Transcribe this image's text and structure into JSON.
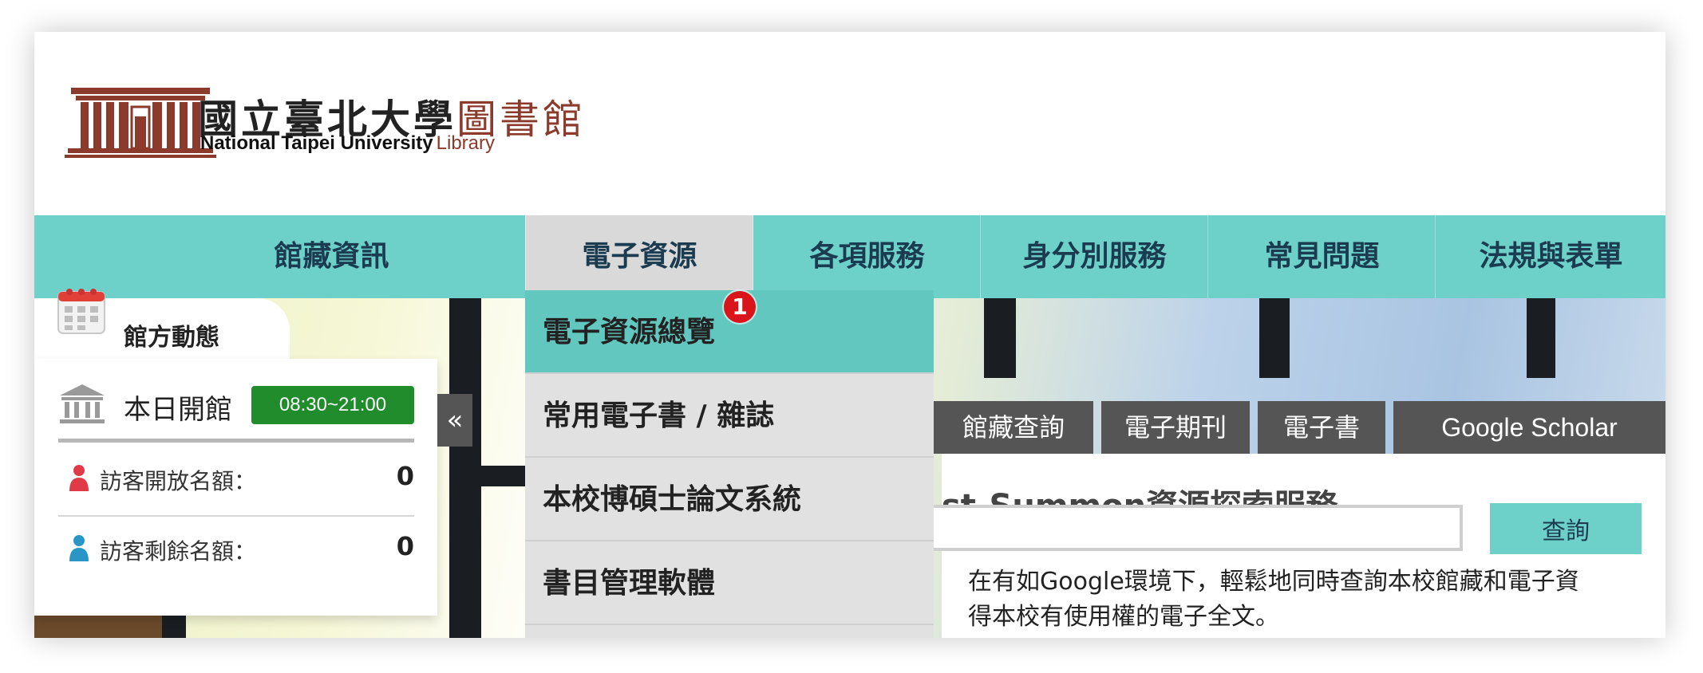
{
  "header": {
    "title_zh_main": "國立臺北大學",
    "title_zh_library": "圖書館",
    "title_en_main": "National Taipei University",
    "title_en_library": "Library"
  },
  "nav": {
    "items": [
      {
        "label": "館藏資訊"
      },
      {
        "label": "電子資源"
      },
      {
        "label": "各項服務"
      },
      {
        "label": "身分別服務"
      },
      {
        "label": "常見問題"
      },
      {
        "label": "法規與表單"
      }
    ],
    "active_index": 1,
    "color": "#6dd0c9"
  },
  "dropdown": {
    "items": [
      {
        "label": "電子資源總覽"
      },
      {
        "label": "常用電子書 / 雜誌"
      },
      {
        "label": "本校博碩士論文系統"
      },
      {
        "label": "書目管理軟體"
      }
    ],
    "badge": "1"
  },
  "panel": {
    "title": "館方動態",
    "open_label": "本日開館",
    "hours": "08:30~21:00",
    "visitors_open_label": "訪客開放名額：",
    "visitors_open_value": "0",
    "visitors_remaining_label": "訪客剩餘名額：",
    "visitors_remaining_value": "0",
    "collapse_glyph": "«"
  },
  "search": {
    "tabs": [
      {
        "label": "館藏查詢"
      },
      {
        "label": "電子期刊"
      },
      {
        "label": "電子書"
      },
      {
        "label": "Google Scholar"
      }
    ],
    "title": "st-Summon資源探索服務",
    "input_value": "",
    "button_label": "查詢",
    "description_line1": "在有如Google環境下，輕鬆地同時查詢本校館藏和電子資",
    "description_line2": "得本校有使用權的電子全文。"
  }
}
